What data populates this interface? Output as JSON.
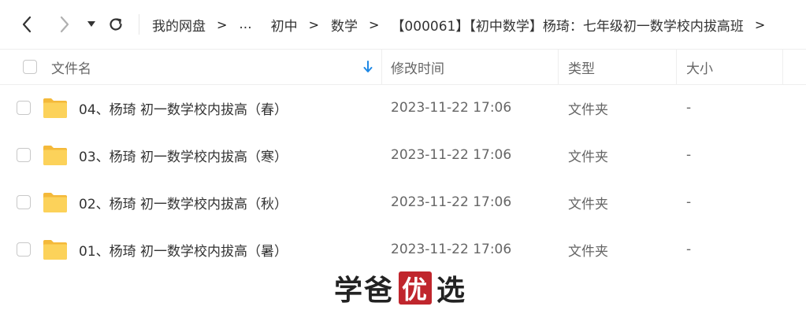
{
  "nav": {
    "back_icon": "chevron-left-icon",
    "forward_icon": "chevron-right-icon",
    "dropdown_icon": "caret-down-icon",
    "refresh_icon": "refresh-icon",
    "breadcrumbs": [
      "我的网盘",
      "...",
      "初中",
      "数学",
      "【000061】【初中数学】杨琦：七年级初一数学校内拔高班"
    ],
    "separator": ">"
  },
  "table": {
    "columns": {
      "name": "文件名",
      "modified": "修改时间",
      "type": "类型",
      "size": "大小"
    },
    "sort_icon": "arrow-down-icon",
    "sort_color": "#1e88e5",
    "folder_color": "#f9c642",
    "rows": [
      {
        "name": "04、杨琦 初一数学校内拔高（春）",
        "modified": "2023-11-22 17:06",
        "type": "文件夹",
        "size": "-"
      },
      {
        "name": "03、杨琦 初一数学校内拔高（寒）",
        "modified": "2023-11-22 17:06",
        "type": "文件夹",
        "size": "-"
      },
      {
        "name": "02、杨琦 初一数学校内拔高（秋）",
        "modified": "2023-11-22 17:06",
        "type": "文件夹",
        "size": "-"
      },
      {
        "name": "01、杨琦 初一数学校内拔高（暑）",
        "modified": "2023-11-22 17:06",
        "type": "文件夹",
        "size": "-"
      }
    ]
  },
  "watermark": {
    "left": "学爸",
    "seal": "优",
    "right": "选",
    "seal_color": "#c0262d"
  }
}
